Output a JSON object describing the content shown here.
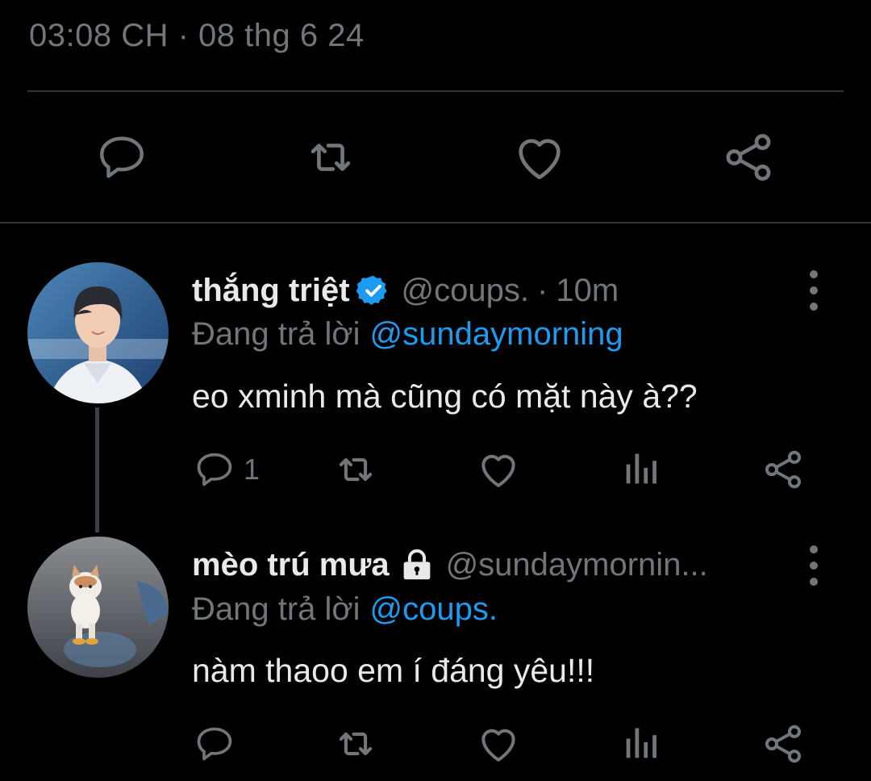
{
  "header": {
    "timestamp": "03:08 CH · 08 thg 6 24"
  },
  "main_actions": {
    "icons": [
      "reply-icon",
      "retweet-icon",
      "like-icon",
      "share-icon"
    ]
  },
  "tweets": [
    {
      "display_name": "thắng triệt",
      "verified": true,
      "handle": "@coups.",
      "separator": "·",
      "time": "10m",
      "reply_prefix": "Đang trả lời",
      "reply_to": "@sundaymorning",
      "text": "eo xminh mà cũng có mặt này à??",
      "reply_count": "1"
    },
    {
      "display_name": "mèo trú mưa",
      "protected": true,
      "handle": "@sundaymornin...",
      "reply_prefix": "Đang trả lời",
      "reply_to": "@coups.",
      "text": "nàm thaoo em í đáng yêu!!!",
      "reply_count": ""
    }
  ],
  "colors": {
    "background": "#000000",
    "text": "#e7e9ea",
    "muted": "#71767b",
    "accent": "#1d9bf0",
    "divider": "#2f3336"
  }
}
